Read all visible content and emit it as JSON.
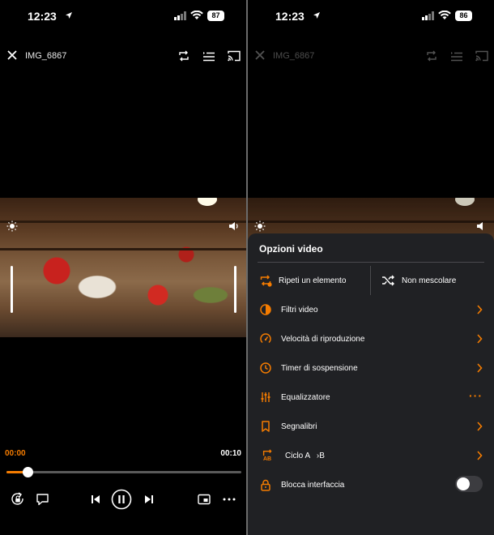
{
  "accent_color": "#f57c00",
  "left": {
    "status": {
      "time": "12:23",
      "battery": "87"
    },
    "title": "IMG_6867",
    "player": {
      "current_time": "00:00",
      "total_time": "00:10",
      "progress": 0.09
    },
    "icons": [
      "close-icon",
      "repeat-icon",
      "playlist-icon",
      "cast-icon",
      "brightness-icon",
      "volume-icon",
      "rotation-lock-icon",
      "subtitles-icon",
      "previous-icon",
      "pause-icon",
      "next-icon",
      "aspect-ratio-icon",
      "more-icon"
    ]
  },
  "right": {
    "status": {
      "time": "12:23",
      "battery": "86"
    },
    "title": "IMG_6867",
    "sheet": {
      "title": "Opzioni video",
      "repeat_label": "Ripeti un elemento",
      "shuffle_label": "Non mescolare",
      "items": [
        {
          "label": "Filtri video",
          "icon": "contrast-icon",
          "trail": "chevron"
        },
        {
          "label": "Velocità di riproduzione",
          "icon": "speed-icon",
          "trail": "chevron"
        },
        {
          "label": "Timer di sospensione",
          "icon": "timer-icon",
          "trail": "chevron"
        },
        {
          "label": "Equalizzatore",
          "icon": "equalizer-icon",
          "trail": "more"
        },
        {
          "label": "Segnalibri",
          "icon": "bookmark-icon",
          "trail": "chevron"
        },
        {
          "label": "Ciclo A   ›B",
          "icon": "ab-loop-icon",
          "trail": "chevron",
          "badge": "AB"
        },
        {
          "label": "Blocca interfaccia",
          "icon": "lock-icon",
          "trail": "toggle",
          "toggle_on": false
        }
      ]
    }
  }
}
